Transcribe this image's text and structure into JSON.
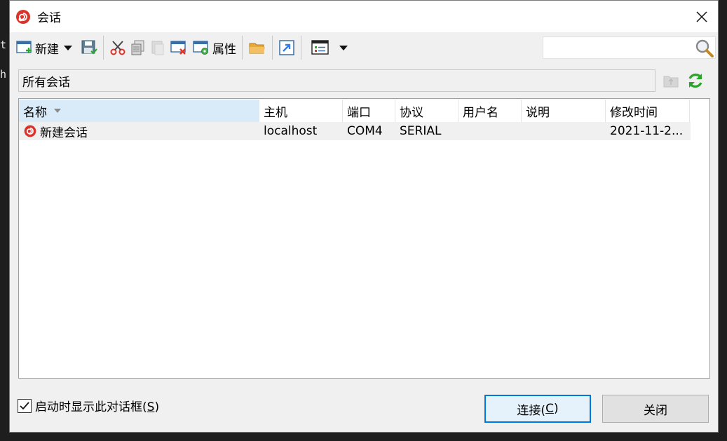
{
  "background": {
    "line1": "t",
    "line2": "h"
  },
  "window": {
    "title": "会话"
  },
  "toolbar": {
    "new_label": "新建",
    "properties_label": "属性"
  },
  "search": {
    "placeholder": ""
  },
  "path": {
    "current": "所有会话"
  },
  "table": {
    "columns": [
      "名称",
      "主机",
      "端口",
      "协议",
      "用户名",
      "说明",
      "修改时间"
    ],
    "rows": [
      {
        "name": "新建会话",
        "host": "localhost",
        "port": "COM4",
        "protocol": "SERIAL",
        "user": "",
        "desc": "",
        "modified": "2021-11-2..."
      }
    ]
  },
  "footer": {
    "show_on_startup_label": "启动时显示此对话框(",
    "show_on_startup_key": "S",
    "show_on_startup_tail": ")",
    "show_on_startup_checked": true,
    "connect_label": "连接(",
    "connect_key": "C",
    "connect_tail": ")",
    "close_label": "关闭"
  },
  "colors": {
    "accent": "#0078d7",
    "selection": "#d9ebf9",
    "refresh_green": "#2aa52a",
    "brand_red": "#d9342b"
  }
}
